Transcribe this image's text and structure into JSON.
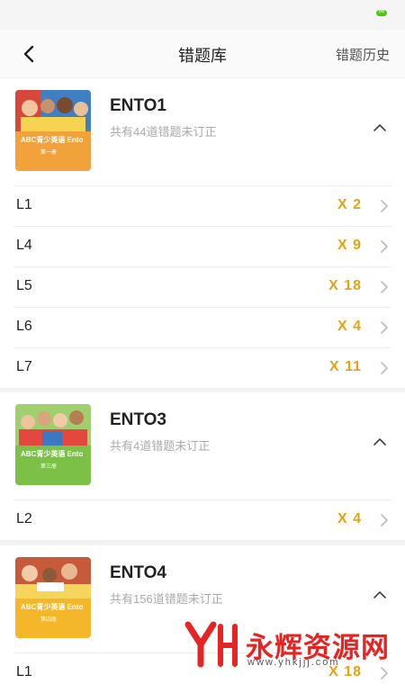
{
  "status": {
    "battery_level": "66"
  },
  "header": {
    "title": "错题库",
    "history_label": "错题历史"
  },
  "books": [
    {
      "name": "ENTO1",
      "subtitle": "共有44道错题未订正",
      "cover_title": "ABC青少英语 Ento",
      "cover_sub": "第一册",
      "cover_color": "#f2a23a",
      "lessons": [
        {
          "name": "L1",
          "count": "X 2"
        },
        {
          "name": "L4",
          "count": "X 9"
        },
        {
          "name": "L5",
          "count": "X 18"
        },
        {
          "name": "L6",
          "count": "X 4"
        },
        {
          "name": "L7",
          "count": "X 11"
        }
      ]
    },
    {
      "name": "ENTO3",
      "subtitle": "共有4道错题未订正",
      "cover_title": "ABC青少英语 Ento",
      "cover_sub": "第三册",
      "cover_color": "#7cc047",
      "lessons": [
        {
          "name": "L2",
          "count": "X 4"
        }
      ]
    },
    {
      "name": "ENTO4",
      "subtitle": "共有156道错题未订正",
      "cover_title": "ABC青少英语 Ento",
      "cover_sub": "第四册",
      "cover_color": "#f5b72a",
      "lessons": [
        {
          "name": "L1",
          "count": "X 18"
        }
      ]
    }
  ],
  "watermark": {
    "text": "永辉资源网",
    "url": "www.yhkjjj.com"
  },
  "colors": {
    "accent": "#e5a312",
    "watermark": "#e52424"
  }
}
